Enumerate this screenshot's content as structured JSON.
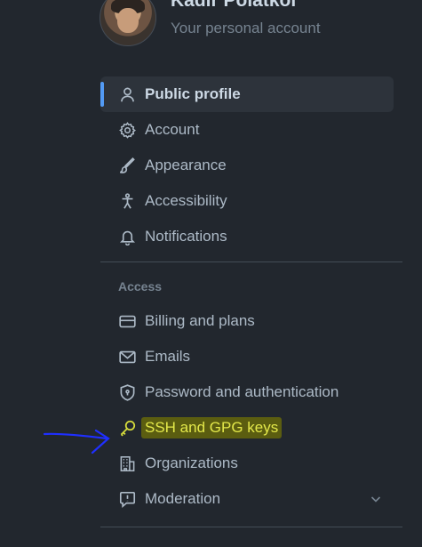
{
  "profile": {
    "name": "Kadir Polatkol",
    "subtitle": "Your personal account"
  },
  "nav": {
    "items": [
      {
        "label": "Public profile",
        "icon": "person-icon",
        "active": true
      },
      {
        "label": "Account",
        "icon": "gear-icon"
      },
      {
        "label": "Appearance",
        "icon": "paintbrush-icon"
      },
      {
        "label": "Accessibility",
        "icon": "accessibility-icon"
      },
      {
        "label": "Notifications",
        "icon": "bell-icon"
      }
    ],
    "access_label": "Access",
    "access_items": [
      {
        "label": "Billing and plans",
        "icon": "credit-card-icon"
      },
      {
        "label": "Emails",
        "icon": "mail-icon"
      },
      {
        "label": "Password and authentication",
        "icon": "shield-lock-icon"
      },
      {
        "label": "SSH and GPG keys",
        "icon": "key-icon",
        "highlighted": true
      },
      {
        "label": "Organizations",
        "icon": "organization-icon"
      },
      {
        "label": "Moderation",
        "icon": "report-icon",
        "expandable": true
      }
    ]
  },
  "colors": {
    "background": "#22272e",
    "active_bg": "#2d333b",
    "accent": "#539bf5",
    "highlight_bg": "#5b5d10",
    "highlight_text": "#e3e84a",
    "annotation_arrow": "#1f2fff"
  }
}
